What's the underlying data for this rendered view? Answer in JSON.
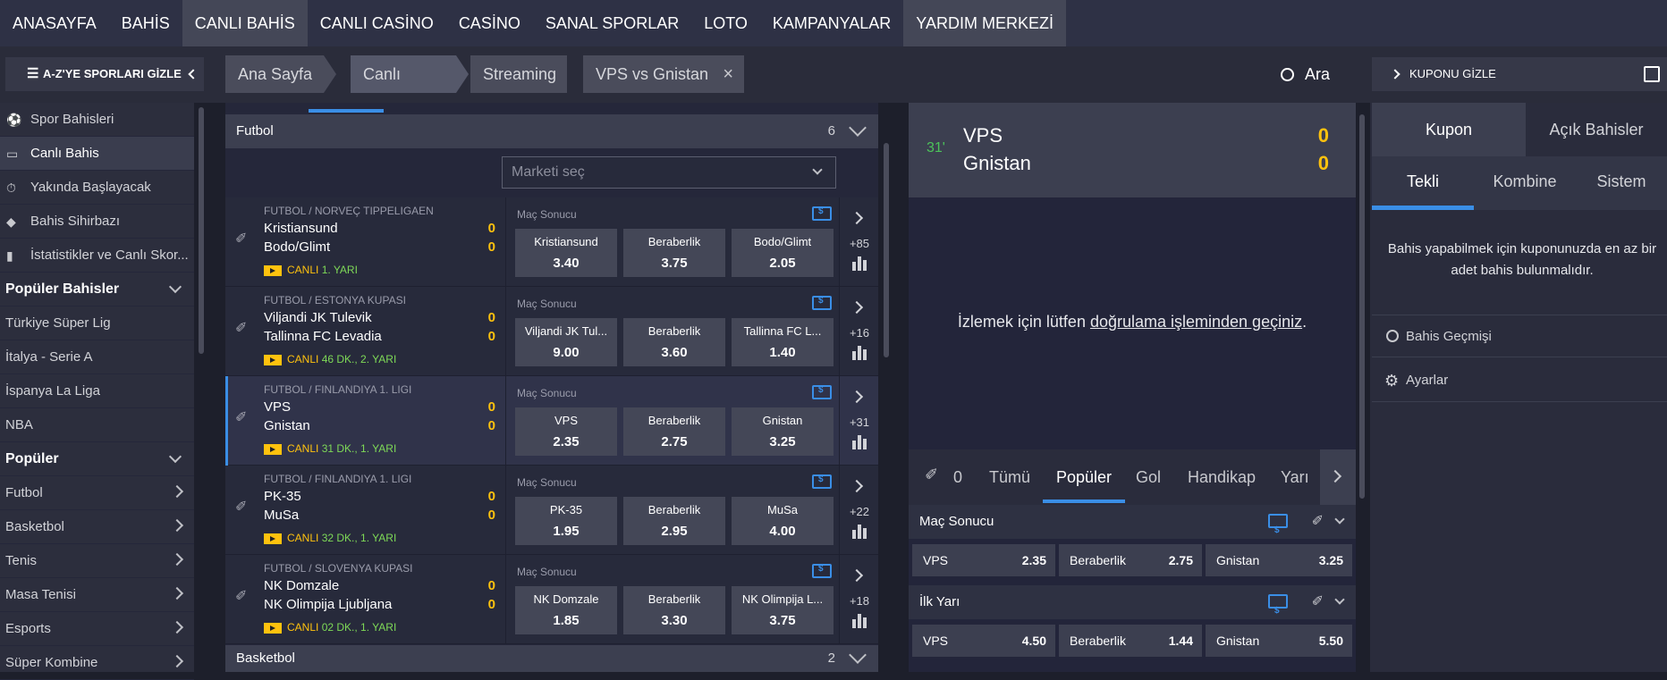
{
  "topnav": [
    "ANASAYFA",
    "BAHİS",
    "CANLI BAHİS",
    "CANLI CASİNO",
    "CASİNO",
    "SANAL SPORLAR",
    "LOTO",
    "KAMPANYALAR",
    "YARDIM MERKEZİ"
  ],
  "subbar": {
    "hide_sports": "A-Z'YE SPORLARI GİZLE",
    "breadcrumb": [
      "Ana Sayfa",
      "Canlı",
      "Streaming"
    ],
    "active_tab": "VPS vs Gnistan",
    "search": "Ara",
    "hide_coupon": "KUPONU GİZLE"
  },
  "sidebar": {
    "items": [
      "Spor Bahisleri",
      "Canlı Bahis",
      "Yakında Başlayacak",
      "Bahis Sihirbazı",
      "İstatistikler ve Canlı Skor..."
    ],
    "popular_bets_title": "Popüler Bahisler",
    "popular_bets": [
      "Türkiye Süper Lig",
      "İtalya - Serie A",
      "İspanya La Liga",
      "NBA"
    ],
    "popular_title": "Popüler",
    "popular": [
      "Futbol",
      "Basketbol",
      "Tenis",
      "Masa Tenisi",
      "Esports",
      "Süper Kombine"
    ]
  },
  "center": {
    "section": "Futbol",
    "section_count": "6",
    "market_select": "Marketi seç",
    "next_section": "Basketbol",
    "next_section_count": "2",
    "matches": [
      {
        "league": "FUTBOL / NORVEÇ TIPPELIGAEN",
        "home": "Kristiansund",
        "away": "Bodo/Glimt",
        "hs": "0",
        "as": "0",
        "live": "CANLI",
        "time": "1. YARI",
        "market": "Maç Sonucu",
        "o1n": "Kristiansund",
        "o1": "3.40",
        "oxn": "Beraberlik",
        "ox": "3.75",
        "o2n": "Bodo/Glimt",
        "o2": "2.05",
        "more": "+85"
      },
      {
        "league": "FUTBOL / ESTONYA KUPASI",
        "home": "Viljandi JK Tulevik",
        "away": "Tallinna FC Levadia",
        "hs": "0",
        "as": "0",
        "live": "CANLI",
        "time": "46 DK., 2. YARI",
        "market": "Maç Sonucu",
        "o1n": "Viljandi JK Tul...",
        "o1": "9.00",
        "oxn": "Beraberlik",
        "ox": "3.60",
        "o2n": "Tallinna FC L...",
        "o2": "1.40",
        "more": "+16"
      },
      {
        "league": "FUTBOL / FINLANDIYA 1. LIGI",
        "home": "VPS",
        "away": "Gnistan",
        "hs": "0",
        "as": "0",
        "live": "CANLI",
        "time": "31 DK., 1. YARI",
        "market": "Maç Sonucu",
        "o1n": "VPS",
        "o1": "2.35",
        "oxn": "Beraberlik",
        "ox": "2.75",
        "o2n": "Gnistan",
        "o2": "3.25",
        "more": "+31"
      },
      {
        "league": "FUTBOL / FINLANDIYA 1. LIGI",
        "home": "PK-35",
        "away": "MuSa",
        "hs": "0",
        "as": "0",
        "live": "CANLI",
        "time": "32 DK., 1. YARI",
        "market": "Maç Sonucu",
        "o1n": "PK-35",
        "o1": "1.95",
        "oxn": "Beraberlik",
        "ox": "2.95",
        "o2n": "MuSa",
        "o2": "4.00",
        "more": "+22"
      },
      {
        "league": "FUTBOL / SLOVENYA KUPASI",
        "home": "NK Domzale",
        "away": "NK Olimpija Ljubljana",
        "hs": "0",
        "as": "0",
        "live": "CANLI",
        "time": "02 DK., 1. YARI",
        "market": "Maç Sonucu",
        "o1n": "NK Domzale",
        "o1": "1.85",
        "oxn": "Beraberlik",
        "ox": "3.30",
        "o2n": "NK Olimpija L...",
        "o2": "3.75",
        "more": "+18"
      }
    ]
  },
  "event": {
    "minute": "31'",
    "home": "VPS",
    "away": "Gnistan",
    "hs": "0",
    "as": "0",
    "verify_pre": "İzlemek için lütfen ",
    "verify_link": "doğrulama işleminden geçiniz",
    "verify_post": ".",
    "tab_count": "0",
    "tabs": [
      "Tümü",
      "Popüler",
      "Gol",
      "Handikap",
      "Yarı"
    ],
    "markets": [
      {
        "title": "Maç Sonucu",
        "o": [
          [
            "VPS",
            "2.35"
          ],
          [
            "Beraberlik",
            "2.75"
          ],
          [
            "Gnistan",
            "3.25"
          ]
        ]
      },
      {
        "title": "İlk Yarı",
        "o": [
          [
            "VPS",
            "4.50"
          ],
          [
            "Beraberlik",
            "1.44"
          ],
          [
            "Gnistan",
            "5.50"
          ]
        ]
      }
    ]
  },
  "coupon": {
    "tabs": [
      "Kupon",
      "Açık Bahisler"
    ],
    "subtabs": [
      "Tekli",
      "Kombine",
      "Sistem"
    ],
    "empty": "Bahis yapabilmek için kuponunuzda en az bir adet bahis bulunmalıdır.",
    "history": "Bahis Geçmişi",
    "settings": "Ayarlar"
  },
  "colors": {
    "accent": "#3a8ee6",
    "score": "#ffc20e",
    "time": "#7ed957"
  }
}
